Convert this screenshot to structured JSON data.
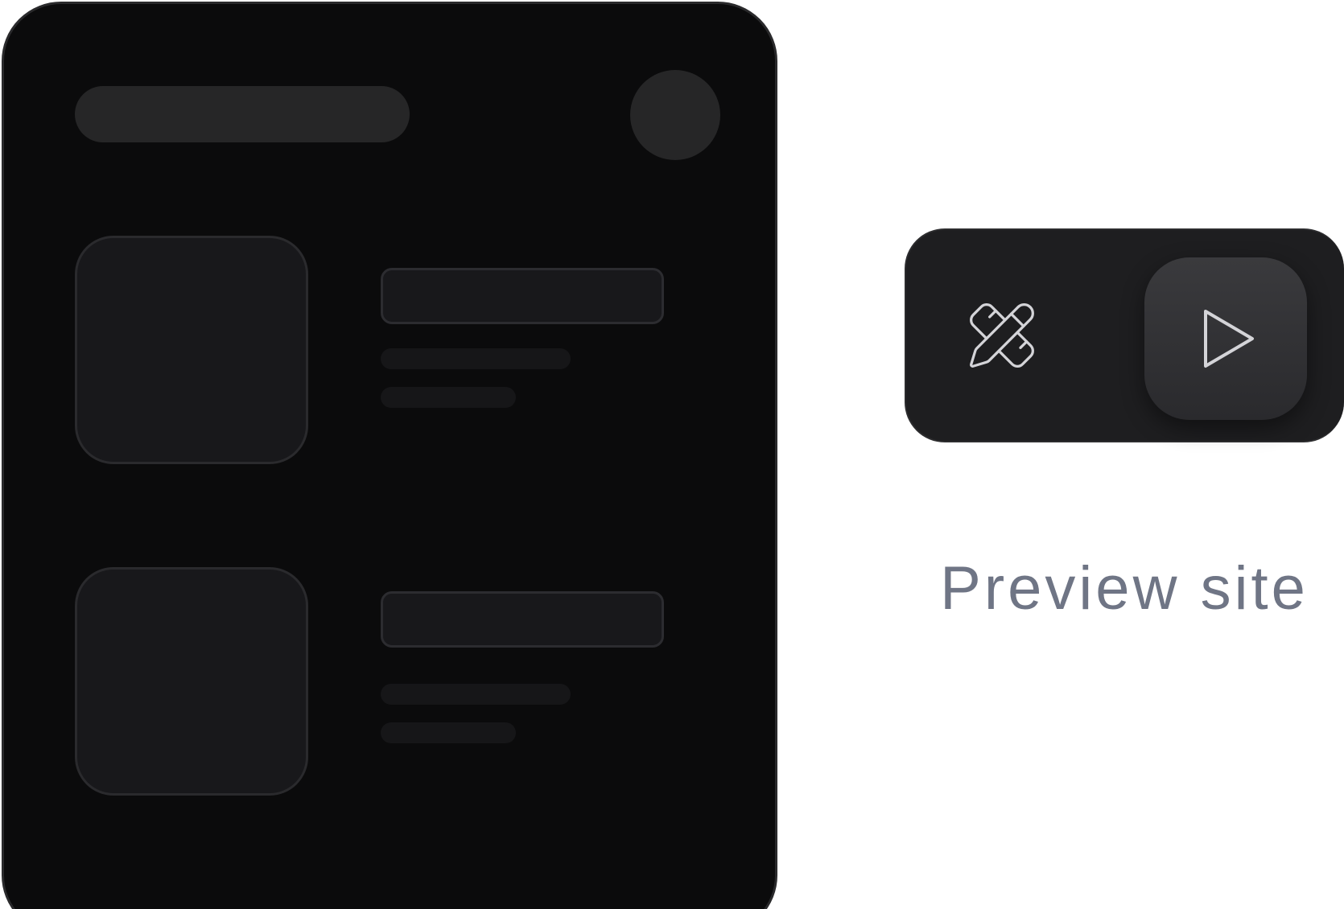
{
  "caption": {
    "label": "Preview site"
  },
  "controls": {
    "design_icon": "pencil-ruler-icon",
    "play_icon": "play-icon"
  },
  "colors": {
    "phone_bg": "#0b0b0c",
    "phone_border": "#2a2a2c",
    "placeholder": "#262627",
    "card": "#18181b",
    "control_bg": "#1e1e20",
    "play_bg": "#333336",
    "caption": "#6f7585",
    "icon_stroke": "#d4d4d8"
  }
}
